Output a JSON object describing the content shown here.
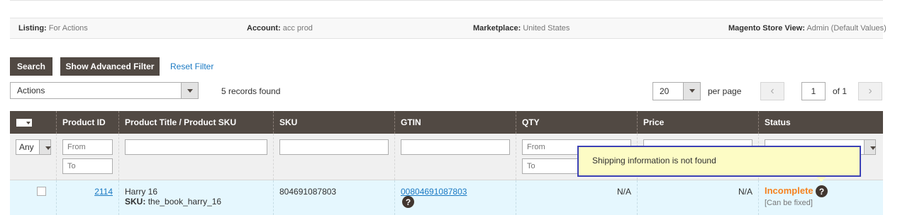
{
  "listing_info": {
    "listing_label": "Listing:",
    "listing_value": "For Actions",
    "account_label": "Account:",
    "account_value": "acc prod",
    "marketplace_label": "Marketplace:",
    "marketplace_value": "United States",
    "store_view_label": "Magento Store View:",
    "store_view_value": "Admin (Default Values)"
  },
  "toolbar": {
    "search_label": "Search",
    "advanced_filter_label": "Show Advanced Filter",
    "reset_filter_label": "Reset Filter",
    "actions_select": "Actions",
    "records_found": "5 records found",
    "per_page_value": "20",
    "per_page_label": "per page",
    "page_value": "1",
    "of_label": "of 1",
    "prev_icon": "chevron-left-icon",
    "next_icon": "chevron-right-icon"
  },
  "grid": {
    "columns": [
      "Product ID",
      "Product Title / Product SKU",
      "SKU",
      "GTIN",
      "QTY",
      "Price",
      "Status"
    ],
    "filters": {
      "mass_select": "Any",
      "product_id_from_placeholder": "From",
      "product_id_to_placeholder": "To",
      "qty_from_placeholder": "From",
      "qty_to_placeholder": "To"
    },
    "rows": [
      {
        "product_id": "2114",
        "title": "Harry 16",
        "sku_label": "SKU:",
        "sku_inline": "the_book_harry_16",
        "sku": "804691087803",
        "gtin": "00804691087803",
        "qty": "N/A",
        "price": "N/A",
        "status": "Incomplete",
        "status_note": "[Can be fixed]"
      }
    ]
  },
  "tooltip": {
    "text": "Shipping information is not found"
  },
  "colors": {
    "header_bg": "#514943",
    "link": "#1979c3",
    "status_incomplete": "#f5821f",
    "row_highlight": "#e5f7fe",
    "tooltip_border": "#3c41b5",
    "tooltip_bg": "#fdfcc5"
  }
}
